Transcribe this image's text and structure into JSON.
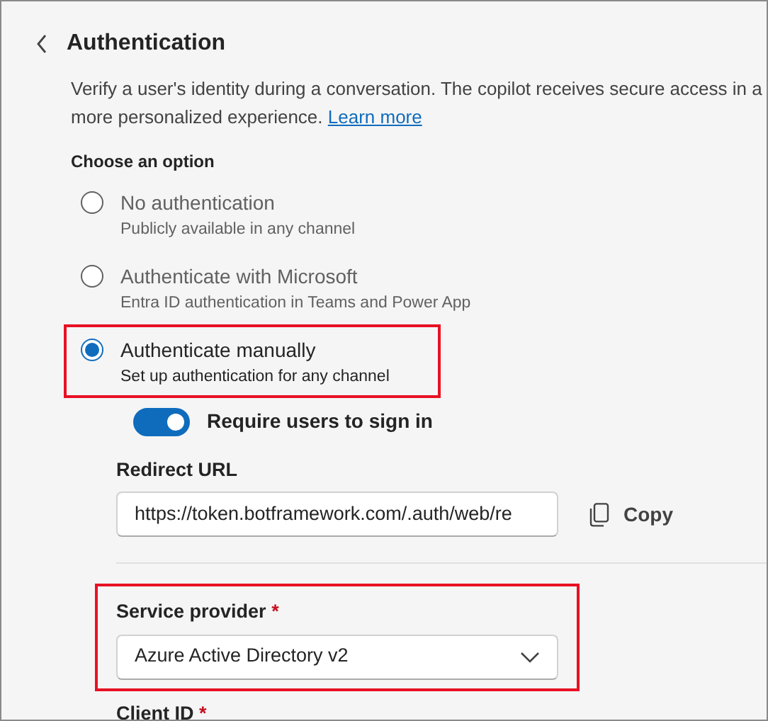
{
  "title": "Authentication",
  "description": {
    "text": "Verify a user's identity during a conversation. The copilot receives secure access in a more personalized experience.",
    "link": "Learn more"
  },
  "options_label": "Choose an option",
  "options": [
    {
      "label": "No authentication",
      "hint": "Publicly available in any channel",
      "selected": false,
      "highlighted": false
    },
    {
      "label": "Authenticate with Microsoft",
      "hint": "Entra ID authentication in Teams and Power App",
      "selected": false,
      "highlighted": false
    },
    {
      "label": "Authenticate manually",
      "hint": "Set up authentication for any channel",
      "selected": true,
      "highlighted": true
    }
  ],
  "require_sign_in": {
    "label": "Require users to sign in",
    "on": true
  },
  "redirect_url": {
    "label": "Redirect URL",
    "value": "https://token.botframework.com/.auth/web/re",
    "copy_label": "Copy"
  },
  "service_provider": {
    "label": "Service provider",
    "required_mark": "*",
    "value": "Azure Active Directory v2",
    "highlighted": true
  },
  "client_id": {
    "label": "Client ID",
    "required_mark": "*"
  }
}
